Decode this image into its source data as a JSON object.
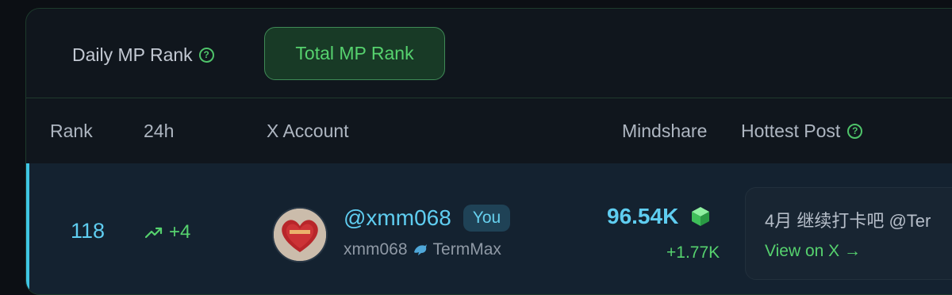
{
  "tabs": {
    "daily_label": "Daily MP Rank",
    "total_label": "Total MP Rank"
  },
  "table": {
    "headers": {
      "rank": "Rank",
      "h24": "24h",
      "account": "X Account",
      "mindshare": "Mindshare",
      "hottest_post": "Hottest Post"
    },
    "row": {
      "rank": "118",
      "change_24h": "+4",
      "handle": "@xmm068",
      "badge": "You",
      "username": "xmm068",
      "username_tag": "TermMax",
      "mindshare": "96.54K",
      "mindshare_change": "+1.77K",
      "post_text": "4月 继续打卡吧 @Ter",
      "post_link": "View on X →"
    }
  },
  "colors": {
    "accent_cyan": "#5fcdf0",
    "accent_green": "#56d26e",
    "panel_bg": "#10161d",
    "row_bg": "#142230"
  },
  "icons": [
    "help-icon",
    "trend-up-icon",
    "dolphin-icon",
    "cube-icon",
    "arrow-right-icon"
  ]
}
